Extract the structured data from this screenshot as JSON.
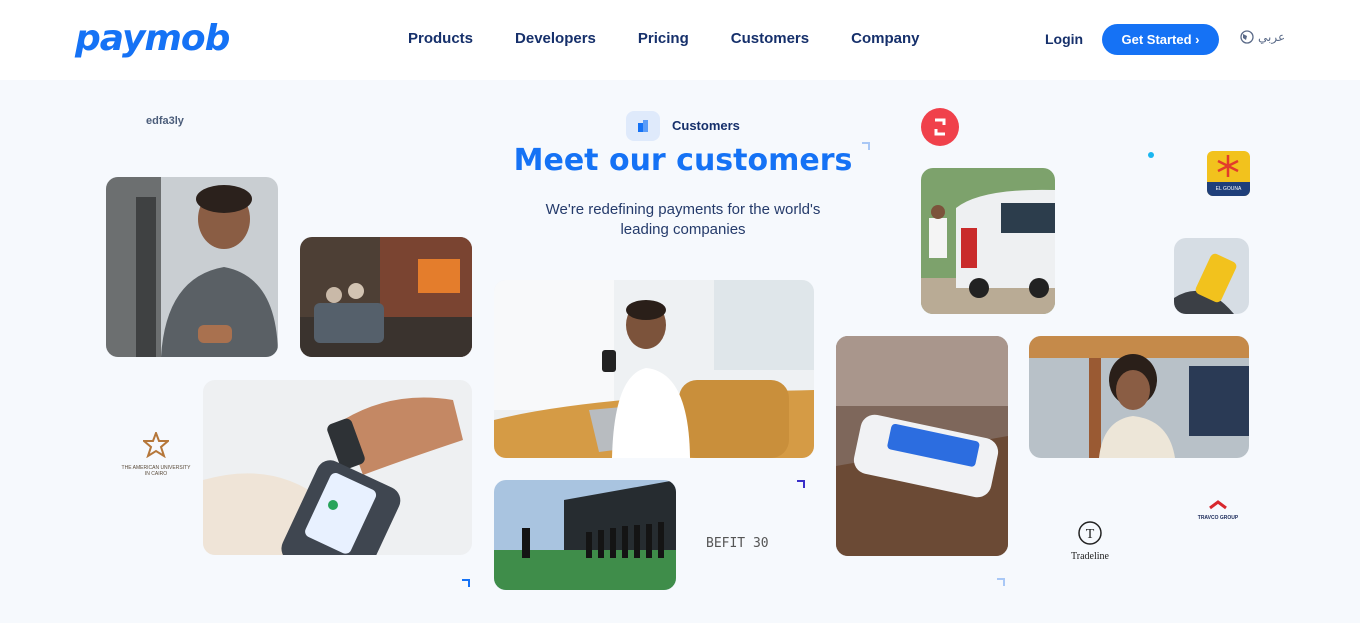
{
  "header": {
    "logo": "paymob",
    "nav": [
      "Products",
      "Developers",
      "Pricing",
      "Customers",
      "Company"
    ],
    "login": "Login",
    "cta": "Get Started ›",
    "language": "عربي"
  },
  "hero": {
    "label": "Customers",
    "title": "Meet our customers",
    "subtitle": "We're redefining payments for the world's leading companies"
  },
  "logos": {
    "edfa3ly": "edfa3ly",
    "auc": "THE AMERICAN UNIVERSITY IN CAIRO",
    "befit": "BEFIT 30",
    "elgouna": "EL GOUNA",
    "tradeline": "Tradeline",
    "travco": "TRAVCO GROUP"
  },
  "colors": {
    "brand_blue": "#1572f5",
    "nav_text": "#16306b",
    "section_bg": "#f6f9fd"
  }
}
